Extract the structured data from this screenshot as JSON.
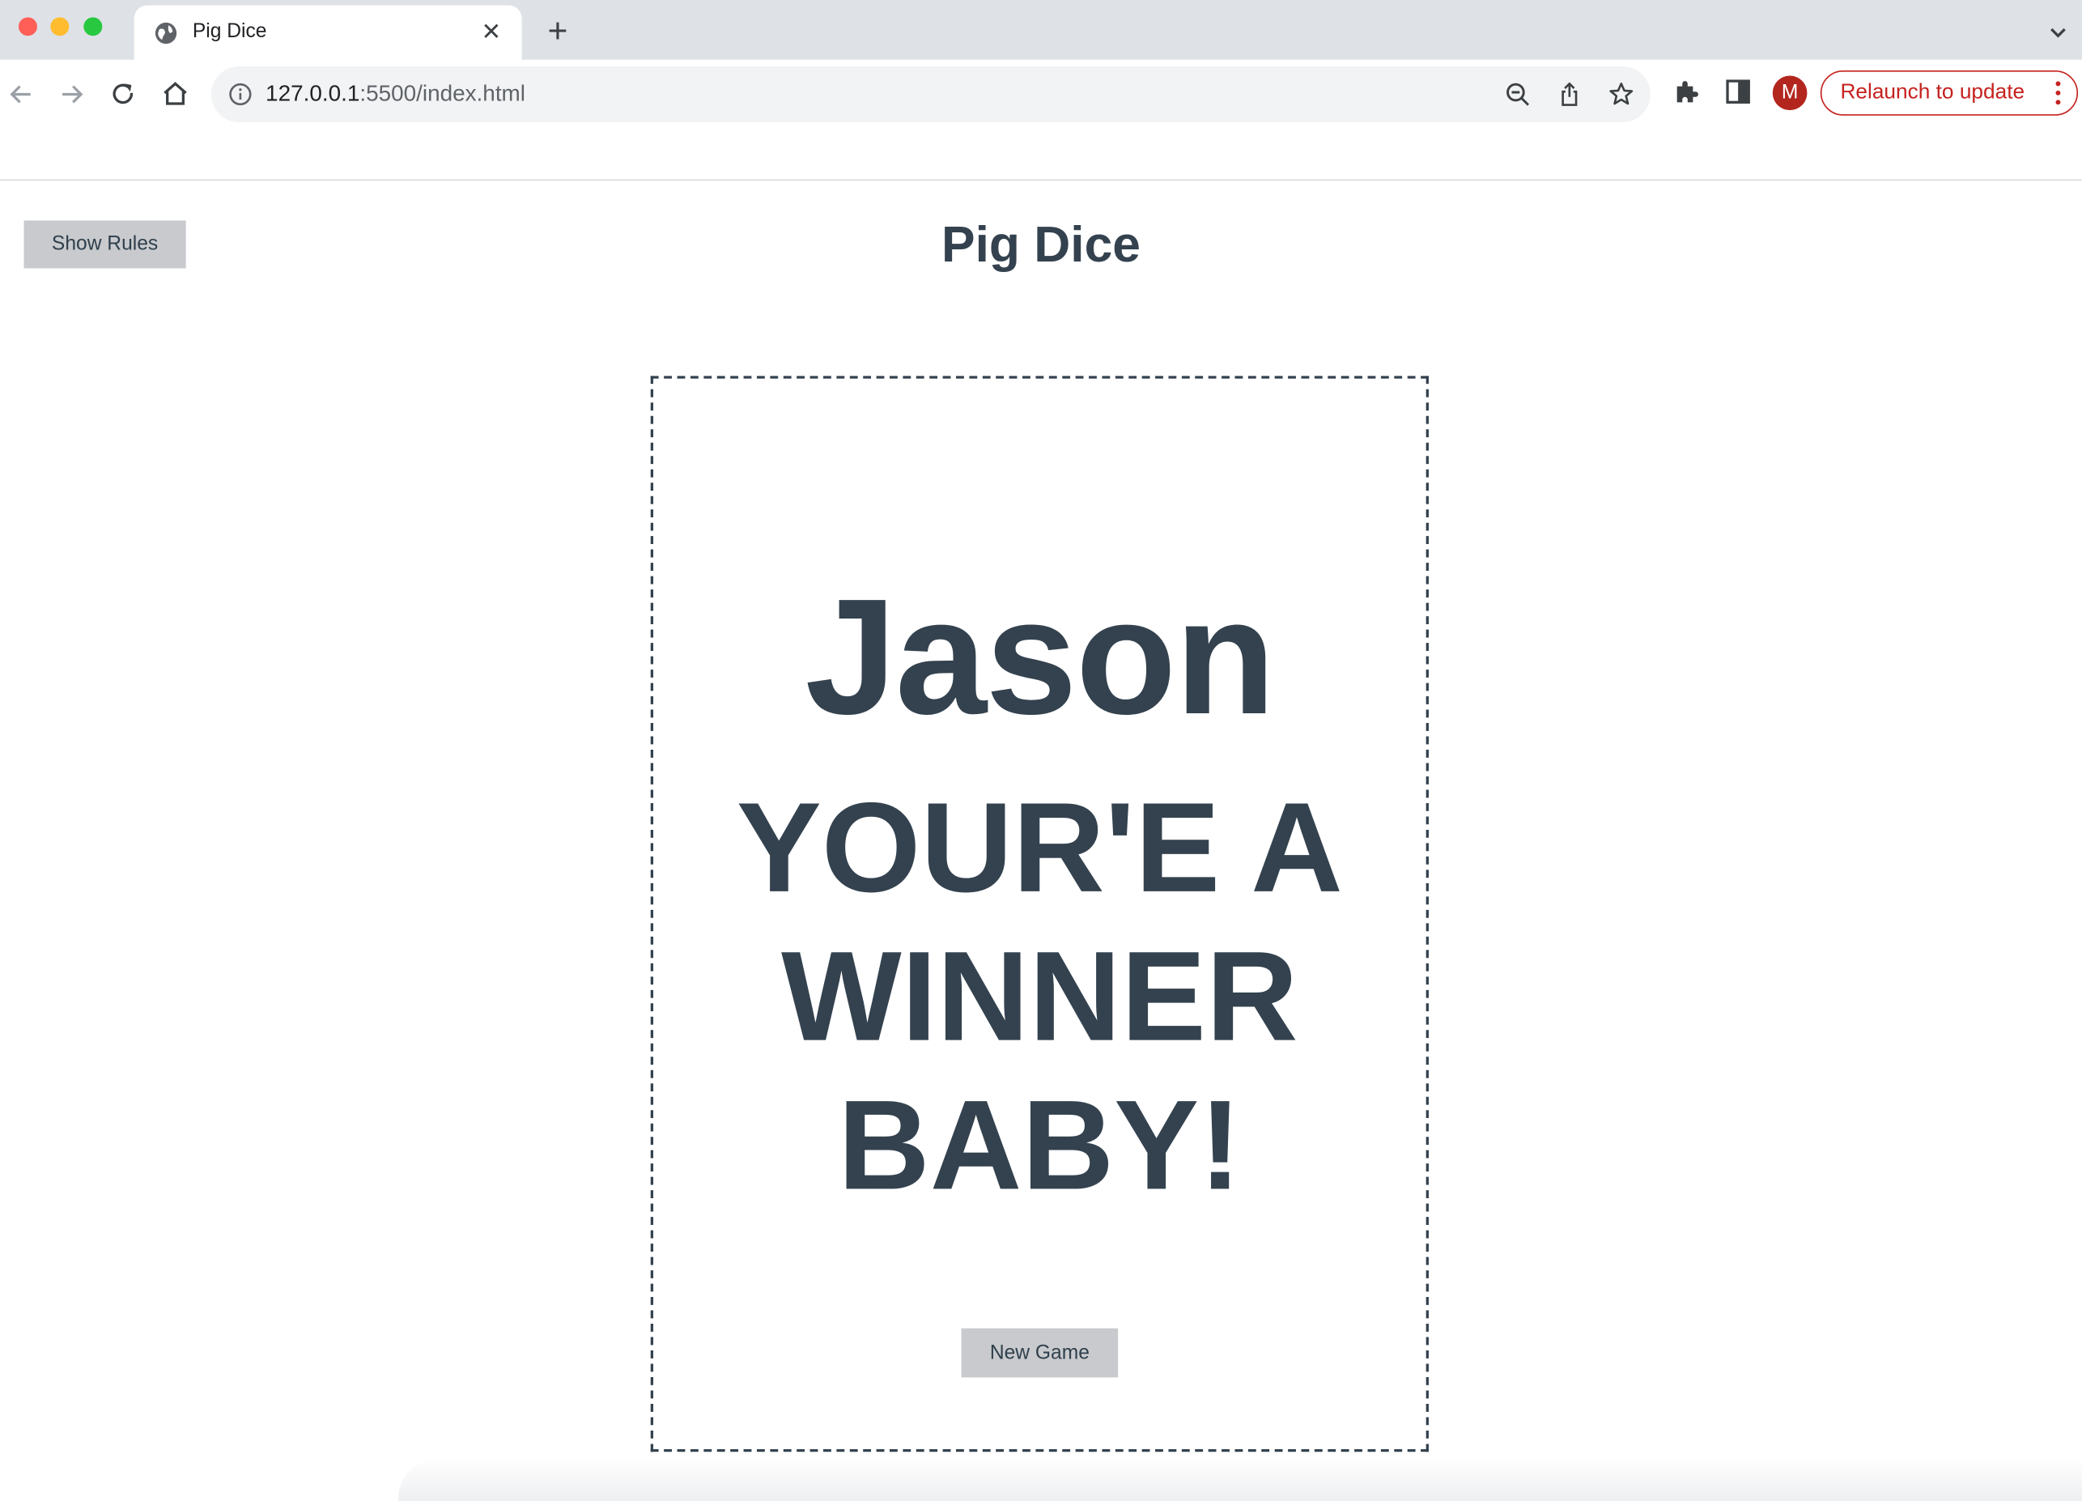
{
  "browser": {
    "tab": {
      "title": "Pig Dice",
      "close_symbol": "✕",
      "icon": "globe-icon"
    },
    "new_tab_symbol": "+",
    "address_bar": {
      "host": "127.0.0.1",
      "rest": ":5500/index.html"
    },
    "profile_initial": "M",
    "relaunch_label": "Relaunch to update",
    "colors": {
      "tabstrip": "#dee1e6",
      "relaunch": "#c5221f",
      "avatar": "#b3261e"
    }
  },
  "page": {
    "show_rules_label": "Show Rules",
    "title": "Pig Dice",
    "winner_name": "Jason",
    "winner_message": "YOUR'E A WINNER BABY!",
    "new_game_label": "New Game",
    "colors": {
      "text": "#34424f",
      "button_bg": "#c8cacd"
    }
  }
}
